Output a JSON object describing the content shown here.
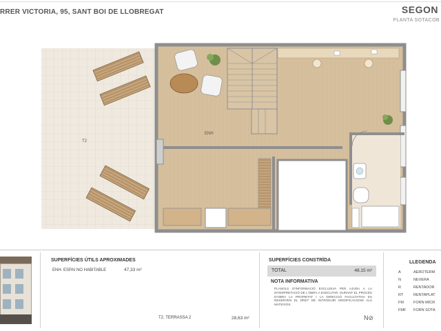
{
  "header": {
    "address": "RRER VICTORIA, 95, SANT BOI DE LLOBREGAT",
    "title": "SEGON",
    "subtitle": "PLANTA SOTACOB"
  },
  "plan": {
    "room_labels": {
      "terrace": "T2",
      "main": "ENH"
    }
  },
  "useful_surfaces": {
    "title": "SUPERFÍCIES ÚTILS APROXIMADES",
    "rows": [
      {
        "label": "ENH. ESPAI NO HABITABLE",
        "value": "47,33 m²"
      },
      {
        "label": "T2. TERRASSA 2",
        "value": "28,63  m²"
      }
    ]
  },
  "built_surface": {
    "title": "SUPERFÍCIES CONSTRÏDA",
    "total_label": "TOTAL",
    "total_value": "48,15 m²"
  },
  "note": {
    "title": "NOTA INFORMATIVA",
    "text": "PLANOLS D'INFORMACIÓ EXCLUSIVA PER AJUDA A LA INTERPRETACIÓ DE L'OBRA A EXECUTAR. DURANT EL PROCÉS D'OBRA LA PROPIETAT I LA DIRECCIÓ FACULTATIVA ES RESERVEN EL DRET DE INTRODUIR MODIFICACIONS ALS MATEIXOS."
  },
  "legend": {
    "title": "LLEGENDA",
    "items": [
      {
        "code": "A",
        "label": "AEROTERM"
      },
      {
        "code": "N",
        "label": "NEVERA"
      },
      {
        "code": "R",
        "label": "RENTADOR"
      },
      {
        "code": "RT",
        "label": "RENTAPLAT"
      },
      {
        "code": "FM",
        "label": "FORN MICR"
      },
      {
        "code": "FMF",
        "label": "FORN SOTA"
      }
    ]
  },
  "colors": {
    "floor": "#d8c3a3",
    "wall": "#8e8e8e",
    "terrace": "#ece6dc",
    "header_bar": "#d9d9d9"
  }
}
